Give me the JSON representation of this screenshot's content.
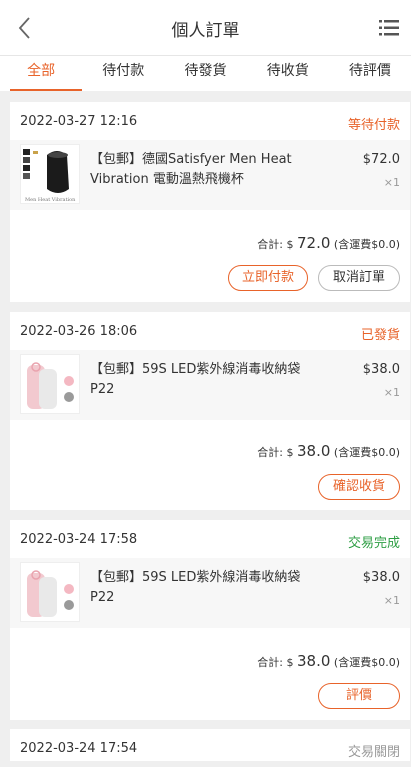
{
  "header": {
    "title": "個人訂單",
    "back_icon": "chevron-left-icon",
    "menu_icon": "list-icon"
  },
  "tabs": [
    {
      "label": "全部",
      "active": true
    },
    {
      "label": "待付款",
      "active": false
    },
    {
      "label": "待發貨",
      "active": false
    },
    {
      "label": "待收貨",
      "active": false
    },
    {
      "label": "待評價",
      "active": false
    }
  ],
  "colors": {
    "accent": "#e8632a",
    "status_orange": "#e8632a",
    "status_green": "#2e9e44",
    "status_gray": "#999999"
  },
  "orders": [
    {
      "date": "2022-03-27 12:16",
      "status": "等待付款",
      "item": {
        "name": "【包郵】德國Satisfyer Men Heat Vibration 電動溫熱飛機杯",
        "price": "$72.0",
        "qty": "×1"
      },
      "total_label": "合計:",
      "total_currency": "$",
      "total_amount": "72.0",
      "shipping": "(含運費$0.0)",
      "buttons": [
        "立即付款",
        "取消訂單"
      ]
    },
    {
      "date": "2022-03-26 18:06",
      "status": "已發貨",
      "item": {
        "name": "【包郵】59S LED紫外線消毒收納袋 P22",
        "price": "$38.0",
        "qty": "×1"
      },
      "total_label": "合計:",
      "total_currency": "$",
      "total_amount": "38.0",
      "shipping": "(含運費$0.0)",
      "buttons": [
        "確認收貨"
      ]
    },
    {
      "date": "2022-03-24 17:58",
      "status": "交易完成",
      "item": {
        "name": "【包郵】59S LED紫外線消毒收納袋 P22",
        "price": "$38.0",
        "qty": "×1"
      },
      "total_label": "合計:",
      "total_currency": "$",
      "total_amount": "38.0",
      "shipping": "(含運費$0.0)",
      "buttons": [
        "評價"
      ]
    },
    {
      "date": "2022-03-24 17:54",
      "status": "交易關閉"
    }
  ]
}
